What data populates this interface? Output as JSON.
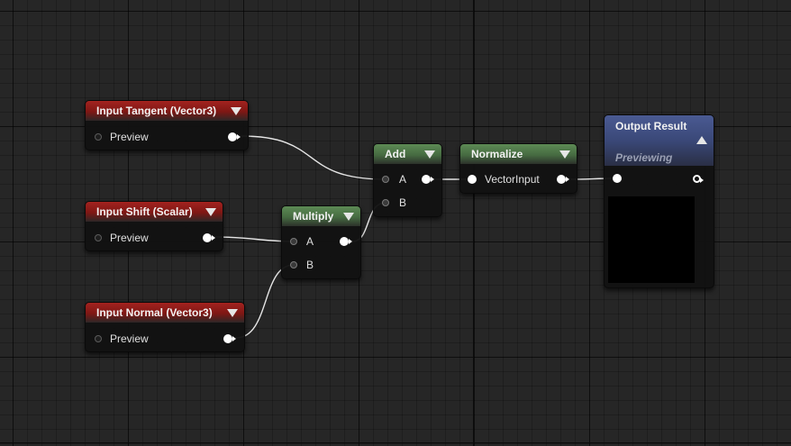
{
  "nodes": {
    "input_tangent": {
      "title": "Input Tangent (Vector3)",
      "pin": "Preview"
    },
    "input_shift": {
      "title": "Input Shift (Scalar)",
      "pin": "Preview"
    },
    "input_normal": {
      "title": "Input Normal (Vector3)",
      "pin": "Preview"
    },
    "multiply": {
      "title": "Multiply",
      "pin_a": "A",
      "pin_b": "B"
    },
    "add": {
      "title": "Add",
      "pin_a": "A",
      "pin_b": "B"
    },
    "normalize": {
      "title": "Normalize",
      "pin": "VectorInput"
    },
    "output": {
      "title": "Output Result",
      "status": "Previewing"
    }
  },
  "colors": {
    "canvas_bg": "#262626",
    "input_header": "#8c1c18",
    "op_header": "#4f7a48",
    "output_header": "#3f4d80",
    "wire": "#e6e6e6"
  }
}
